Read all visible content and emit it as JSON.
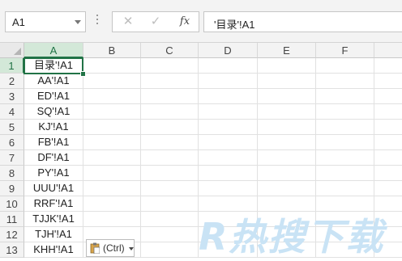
{
  "formula_bar": {
    "name_box": "A1",
    "cancel_glyph": "✕",
    "enter_glyph": "✓",
    "insert_function_label": "fx",
    "formula": "'目录'!A1"
  },
  "columns": [
    "A",
    "B",
    "C",
    "D",
    "E",
    "F"
  ],
  "selected_column": "A",
  "rows": [
    {
      "num": "1",
      "a": "目录'!A1"
    },
    {
      "num": "2",
      "a": "AA'!A1"
    },
    {
      "num": "3",
      "a": "ED'!A1"
    },
    {
      "num": "4",
      "a": "SQ'!A1"
    },
    {
      "num": "5",
      "a": "KJ'!A1"
    },
    {
      "num": "6",
      "a": "FB'!A1"
    },
    {
      "num": "7",
      "a": "DF'!A1"
    },
    {
      "num": "8",
      "a": "PY'!A1"
    },
    {
      "num": "9",
      "a": "UUU'!A1"
    },
    {
      "num": "10",
      "a": "RRF'!A1"
    },
    {
      "num": "11",
      "a": "TJJK'!A1"
    },
    {
      "num": "12",
      "a": "TJH'!A1"
    },
    {
      "num": "13",
      "a": "KHH'!A1"
    }
  ],
  "paste_options": {
    "label": "(Ctrl)"
  },
  "watermark": {
    "text": "R热搜下载"
  },
  "colors": {
    "accent": "#217346",
    "watermark": "#c9e3f5"
  }
}
